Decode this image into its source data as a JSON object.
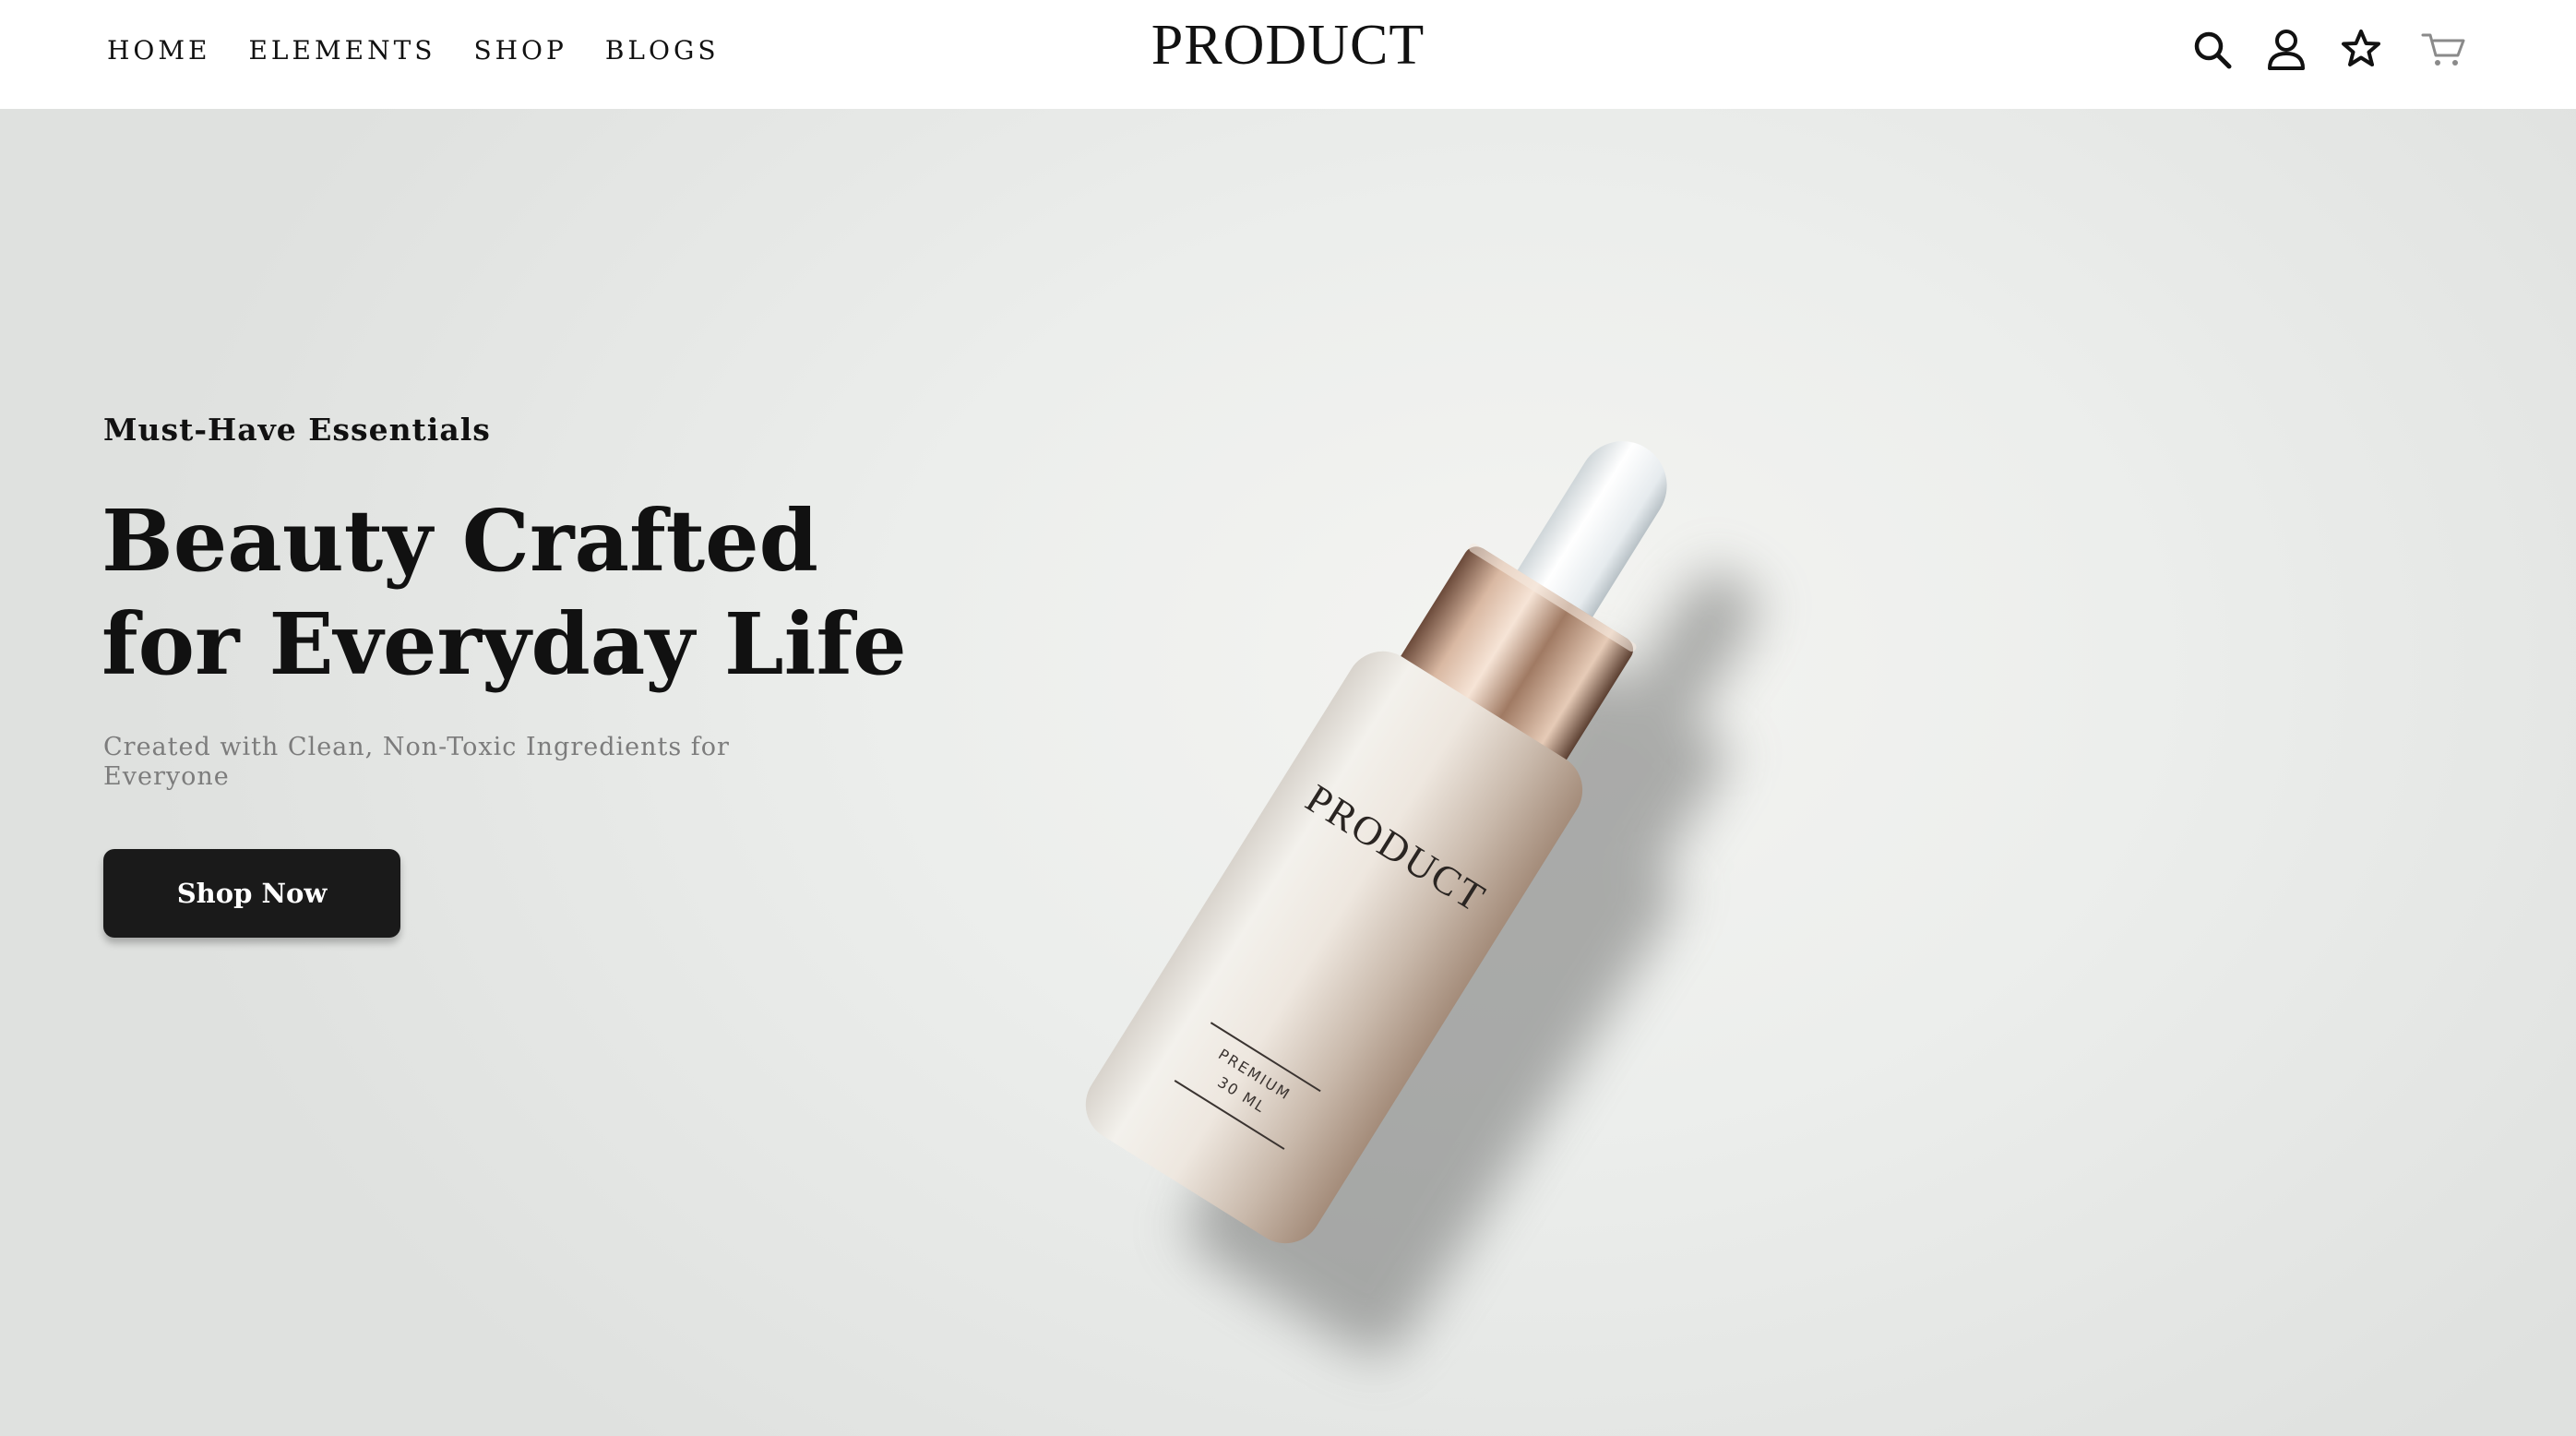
{
  "header": {
    "nav": [
      "HOME",
      "ELEMENTS",
      "SHOP",
      "BLOGS"
    ],
    "logo": "PRODUCT",
    "icons": [
      "search-icon",
      "account-icon",
      "wishlist-star-icon",
      "cart-icon"
    ]
  },
  "hero": {
    "eyebrow": "Must-Have Essentials",
    "headline": [
      "Beauty Crafted",
      "for Everyday Life"
    ],
    "subtext": "Created with Clean, Non-Toxic Ingredients for Everyone",
    "cta": "Shop Now",
    "bottle_label": "PRODUCT",
    "bottle_small_lines": [
      "PREMIUM",
      "30 ML"
    ]
  },
  "colors": {
    "text": "#111111",
    "muted": "#7c7c7c",
    "button": "#1a1a1a",
    "button_text": "#ffffff",
    "cap_gold": "#c9a48b"
  }
}
